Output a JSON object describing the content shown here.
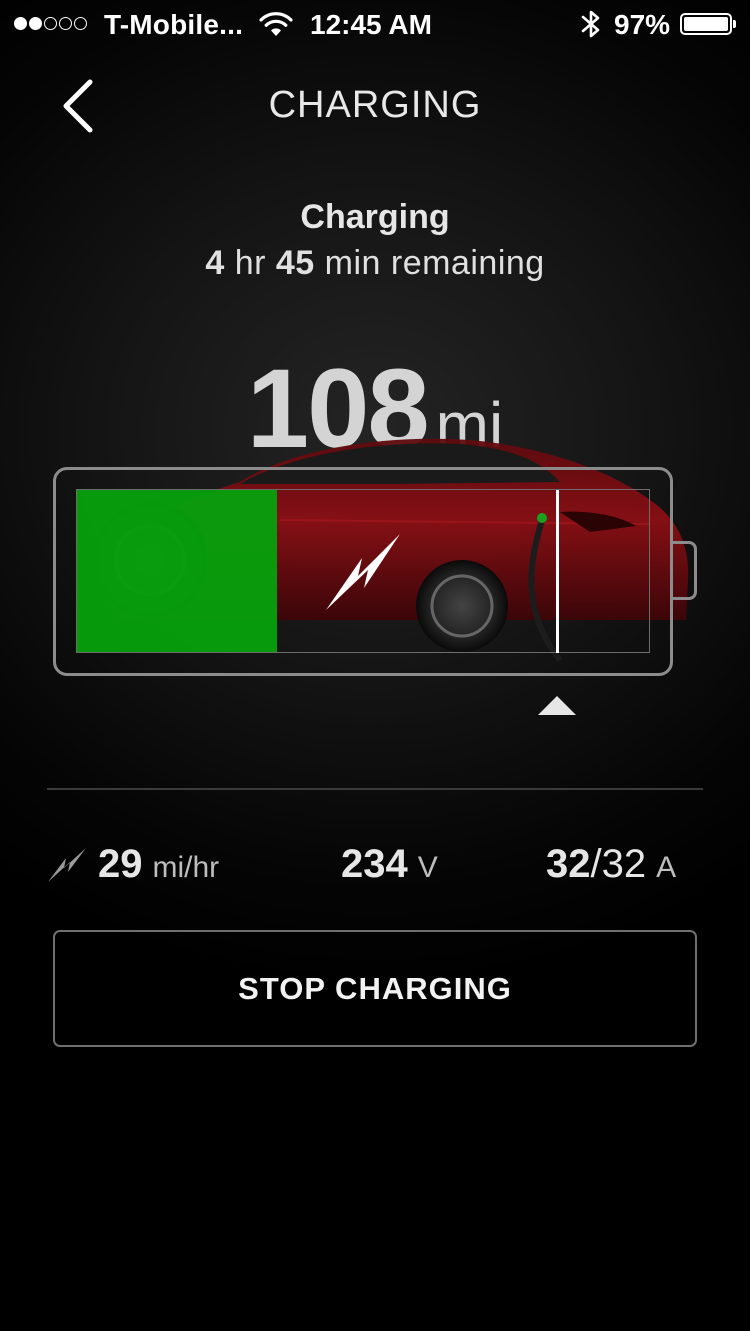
{
  "status_bar": {
    "signal_filled": 2,
    "signal_total": 5,
    "carrier": "T-Mobile...",
    "time": "12:45 AM",
    "battery_percent": "97%"
  },
  "header": {
    "title": "CHARGING",
    "back_icon": "chevron-left-icon"
  },
  "charging": {
    "state": "Charging",
    "remaining_hours": "4",
    "remaining_hours_unit": "hr",
    "remaining_minutes": "45",
    "remaining_suffix": "min remaining",
    "range_value": "108",
    "range_unit": "mi",
    "charge_level": 0.35,
    "charge_limit": 0.84,
    "colors": {
      "charge_fill": "#06a10d",
      "car_body": "#8a0f14"
    }
  },
  "stats": {
    "rate_value": "29",
    "rate_unit": "mi/hr",
    "voltage_value": "234",
    "voltage_unit": "V",
    "current_actual": "32",
    "current_separator": "/",
    "current_max": "32",
    "current_unit": "A"
  },
  "actions": {
    "stop_label": "STOP CHARGING"
  }
}
